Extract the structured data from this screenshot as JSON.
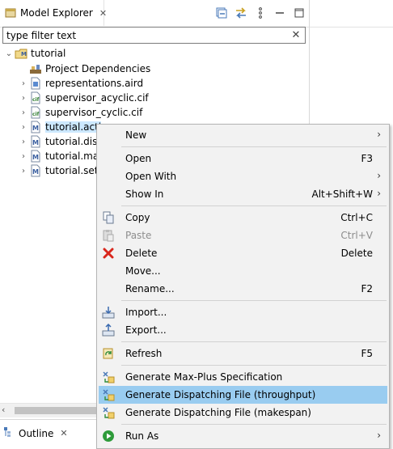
{
  "view": {
    "title": "Model Explorer",
    "close_glyph": "✕"
  },
  "toolbar": {
    "icons": [
      "collapse-all-icon",
      "link-with-editor-icon",
      "view-menu-icon",
      "minimize-icon",
      "maximize-icon"
    ]
  },
  "filter": {
    "value": "type filter text",
    "clear_glyph": "✕"
  },
  "tree": {
    "root": {
      "label": "tutorial",
      "expanded": true
    },
    "items": [
      {
        "label": "Project Dependencies",
        "has_children": false,
        "icon": "dependencies-icon"
      },
      {
        "label": "representations.aird",
        "has_children": true,
        "icon": "aird-file-icon"
      },
      {
        "label": "supervisor_acyclic.cif",
        "has_children": true,
        "icon": "cif-file-icon"
      },
      {
        "label": "supervisor_cyclic.cif",
        "has_children": true,
        "icon": "cif-file-icon"
      },
      {
        "label": "tutorial.acti",
        "has_children": true,
        "icon": "model-file-icon",
        "selected": true
      },
      {
        "label": "tutorial.disp",
        "has_children": true,
        "icon": "model-file-icon"
      },
      {
        "label": "tutorial.mac",
        "has_children": true,
        "icon": "model-file-icon"
      },
      {
        "label": "tutorial.sett",
        "has_children": true,
        "icon": "model-file-icon"
      }
    ]
  },
  "outline": {
    "title": "Outline",
    "close_glyph": "✕"
  },
  "menu": {
    "items": [
      {
        "label": "New",
        "accel": "",
        "submenu": true
      },
      {
        "label": "Open",
        "accel": "F3"
      },
      {
        "label": "Open With",
        "accel": "",
        "submenu": true
      },
      {
        "label": "Show In",
        "accel": "Alt+Shift+W",
        "submenu": true
      },
      {
        "label": "Copy",
        "accel": "Ctrl+C",
        "icon": "copy-icon"
      },
      {
        "label": "Paste",
        "accel": "Ctrl+V",
        "icon": "paste-icon",
        "disabled": true
      },
      {
        "label": "Delete",
        "accel": "Delete",
        "icon": "delete-icon"
      },
      {
        "label": "Move...",
        "accel": ""
      },
      {
        "label": "Rename...",
        "accel": "F2"
      },
      {
        "label": "Import...",
        "accel": "",
        "icon": "import-icon"
      },
      {
        "label": "Export...",
        "accel": "",
        "icon": "export-icon"
      },
      {
        "label": "Refresh",
        "accel": "F5",
        "icon": "refresh-icon"
      },
      {
        "label": "Generate Max-Plus Specification",
        "accel": "",
        "icon": "generate-icon"
      },
      {
        "label": "Generate Dispatching File (throughput)",
        "accel": "",
        "icon": "generate-icon",
        "highlighted": true
      },
      {
        "label": "Generate Dispatching File (makespan)",
        "accel": "",
        "icon": "generate-icon"
      },
      {
        "label": "Run As",
        "accel": "",
        "icon": "run-icon",
        "submenu": true
      }
    ],
    "submenu_glyph": "›"
  },
  "colors": {
    "selection": "#cce8ff",
    "menu_highlight": "#99ccf0",
    "menu_background": "#f2f2f2",
    "delete_red": "#d9261c",
    "run_green": "#2e9b3a"
  }
}
